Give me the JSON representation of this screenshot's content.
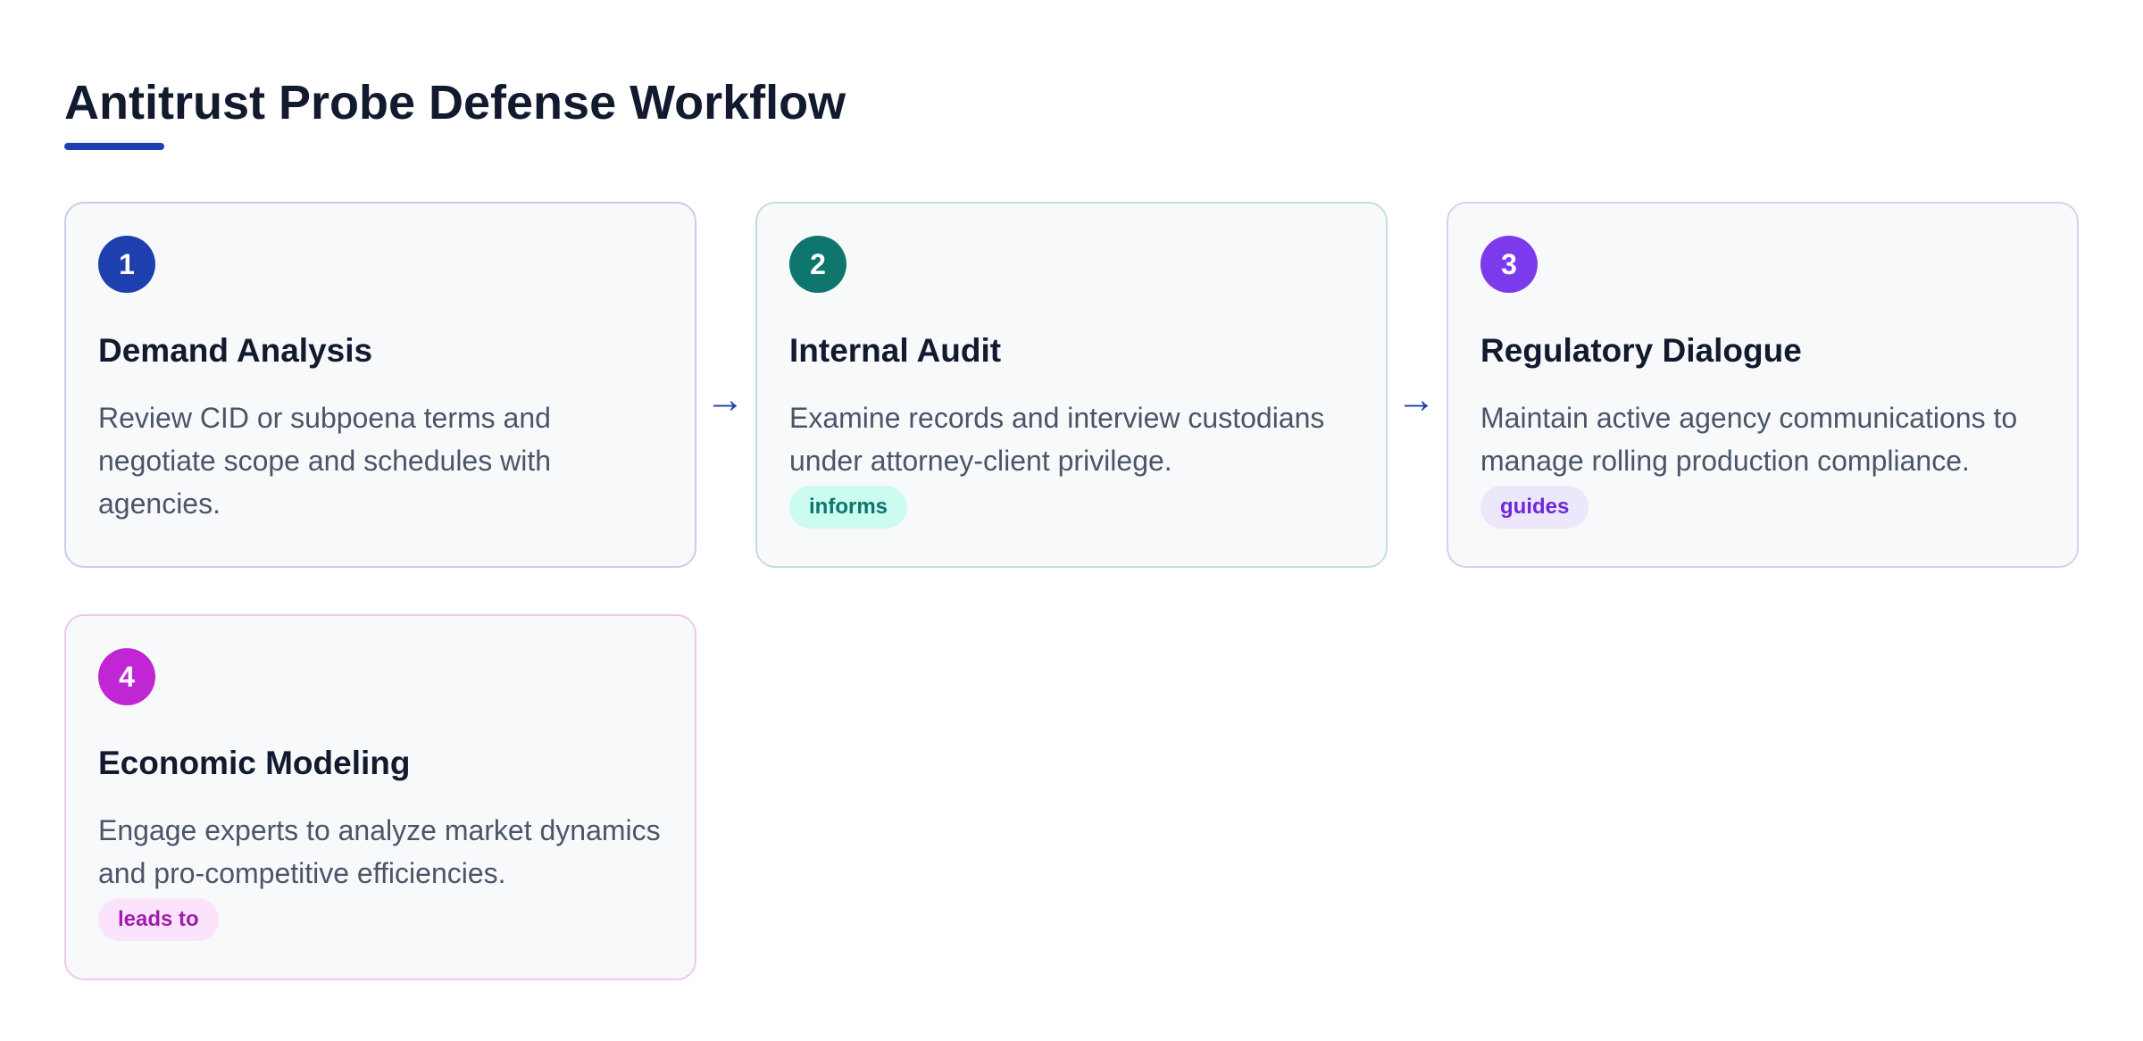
{
  "header": {
    "title": "Antitrust Probe Defense Workflow",
    "accent_color": "#1e40af"
  },
  "steps": [
    {
      "number": "1",
      "title": "Demand Analysis",
      "description": "Review CID or subpoena terms and negotiate scope and schedules with agencies.",
      "badge_color": "#1e3fae",
      "relation": null
    },
    {
      "number": "2",
      "title": "Internal Audit",
      "description": "Examine records and interview custodians under attorney-client privilege.",
      "badge_color": "#0f766e",
      "relation": {
        "label": "informs",
        "bg": "#ccfbef",
        "color": "#0f766e"
      }
    },
    {
      "number": "3",
      "title": "Regulatory Dialogue",
      "description": "Maintain active agency communications to manage rolling production compliance.",
      "badge_color": "#7c3aed",
      "relation": {
        "label": "guides",
        "bg": "#ede7fb",
        "color": "#6d28d9"
      }
    },
    {
      "number": "4",
      "title": "Economic Modeling",
      "description": "Engage experts to analyze market dynamics and pro-competitive efficiencies.",
      "badge_color": "#c026d3",
      "relation": {
        "label": "leads to",
        "bg": "#fbe4fb",
        "color": "#a21caf"
      }
    }
  ],
  "connectors": [
    {
      "symbol": "→"
    },
    {
      "symbol": "→"
    }
  ]
}
